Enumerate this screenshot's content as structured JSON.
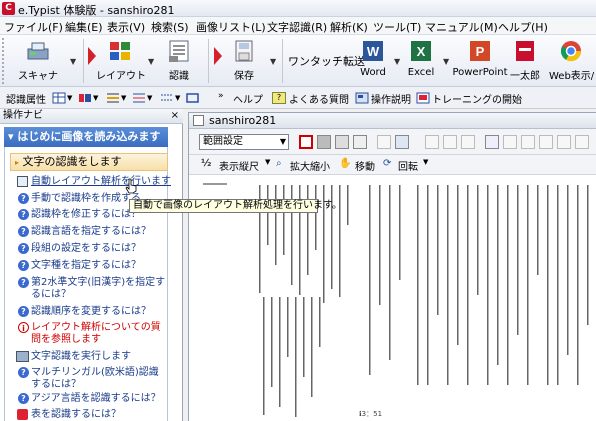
{
  "window": {
    "title": "e.Typist 体験版 - sanshiro281",
    "app_icon": "C"
  },
  "menu": [
    "ファイル(F)",
    "編集(E)",
    "表示(V)",
    "検索(S)",
    "画像リスト(L)",
    "文字認識(R)",
    "解析(K)",
    "ツール(T)",
    "マニュアル(M)",
    "ヘルプ(H)"
  ],
  "ribbon": {
    "scanner": "スキャナ",
    "layout": "レイアウト",
    "recognize": "認識",
    "save": "保存",
    "one_touch": "ワンタッチ転送",
    "word": "Word",
    "excel": "Excel",
    "powerpoint": "PowerPoint",
    "ichitaro": "一太郎",
    "web": "Web表示/"
  },
  "toolbar2": {
    "attr": "認識属性",
    "help": "ヘルプ",
    "faq": "よくある質問",
    "manual": "操作説明",
    "training": "トレーニングの開始"
  },
  "nav": {
    "header": "操作ナビ",
    "close": "×",
    "section1": "はじめに画像を読み込みます",
    "section2": "文字の認識をします",
    "items": [
      "自動レイアウト解析を行います",
      "手動で認識枠を作成する",
      "認識枠を修正するには？",
      "認識言語を指定するには？",
      "段組の設定をするには？",
      "文字種を指定するには？",
      "第2水準文字(旧漢字)を指定するには？",
      "認識順序を変更するには？",
      "レイアウト解析についての質問を参照します",
      "文字認識を実行します",
      "マルチリンガル(欧米語)認識するには？",
      "アジア言語を認識するには？",
      "表を認識するには？"
    ],
    "tooltip": "自動で画像のレイアウト解析処理を行います。"
  },
  "doc": {
    "title": "sanshiro281",
    "range_combo": "範囲設定",
    "vertical": "表示縦尺",
    "zoom": "拡大縮小",
    "move": "移動",
    "rotate": "回転",
    "page_number": "ℹ3：51"
  },
  "colors": {
    "accent": "#3b6cc0",
    "nav_section": "#4a7ccc",
    "brand_red": "#c8102e"
  }
}
